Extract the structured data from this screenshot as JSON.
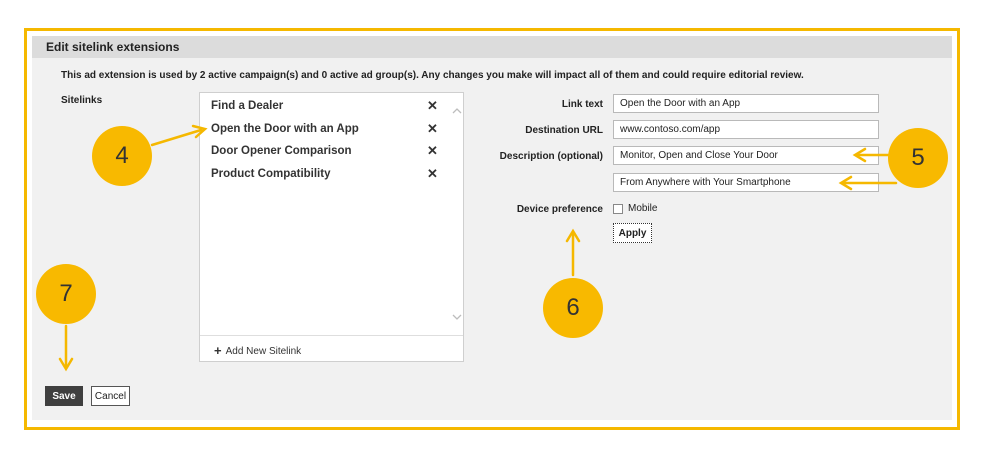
{
  "dialog": {
    "title": "Edit sitelink extensions",
    "notice": "This ad extension is used by 2 active campaign(s) and 0 active ad group(s). Any changes you make will impact all of them and could require editorial review."
  },
  "sitelinks": {
    "label": "Sitelinks",
    "items": [
      {
        "label": "Find a Dealer",
        "remove": "✕"
      },
      {
        "label": "Open the Door with an App",
        "remove": "✕"
      },
      {
        "label": "Door Opener Comparison",
        "remove": "✕"
      },
      {
        "label": "Product Compatibility",
        "remove": "✕"
      }
    ],
    "add_label": "Add New Sitelink",
    "add_icon": "+"
  },
  "form": {
    "link_text_label": "Link text",
    "link_text_value": "Open the Door with an App",
    "destination_url_label": "Destination URL",
    "destination_url_value": "www.contoso.com/app",
    "description_label": "Description (optional)",
    "description_line1": "Monitor, Open and Close Your Door",
    "description_line2": "From Anywhere with Your Smartphone",
    "device_preference_label": "Device preference",
    "mobile_label": "Mobile",
    "mobile_checked": false,
    "apply_label": "Apply"
  },
  "actions": {
    "save_label": "Save",
    "cancel_label": "Cancel"
  },
  "callouts": [
    "4",
    "5",
    "6",
    "7"
  ],
  "colors": {
    "accent": "#f5b800",
    "save_bg": "#3f3f3f",
    "header_bg": "#dcdcdc",
    "panel_bg": "#f1f1f1"
  }
}
